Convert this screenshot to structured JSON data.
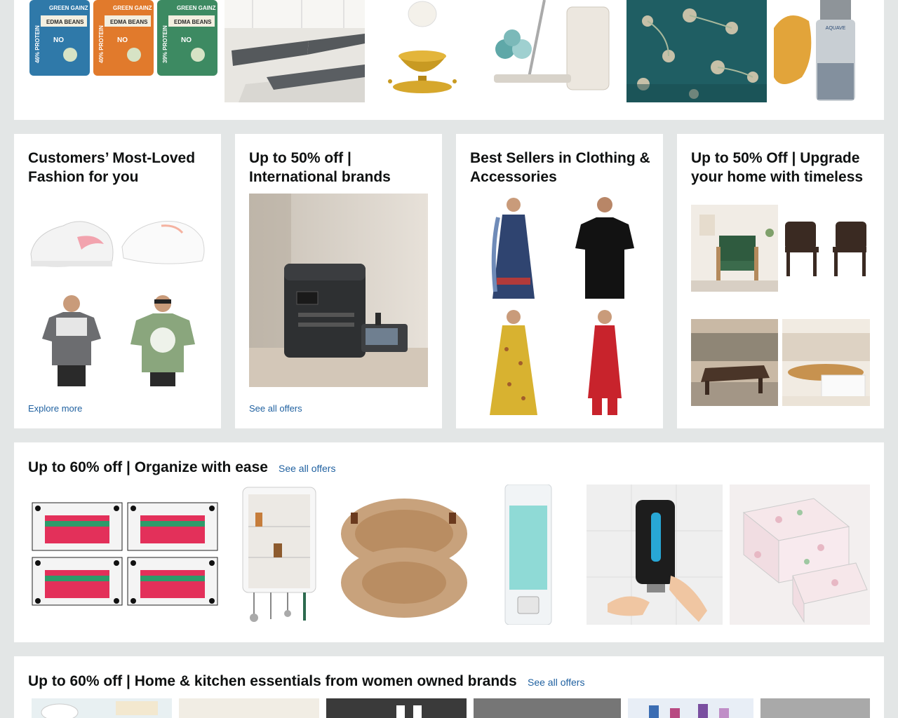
{
  "row1": {
    "products": [
      {
        "icon": "protein-snack-pouches"
      },
      {
        "icon": "kitchen-floor-mats"
      },
      {
        "icon": "brass-diya-lamp"
      },
      {
        "icon": "spin-mop-bucket"
      },
      {
        "icon": "floral-bedsheet"
      },
      {
        "icon": "face-serum-bottle"
      }
    ],
    "pouch_labels": [
      "GREEN GAINZ",
      "EDMA BEANS",
      "NO"
    ],
    "pouch_side": [
      "46% PROTEIN",
      "40% PROTEIN",
      "39% PROTEIN"
    ],
    "serum_label": "AQUAVE"
  },
  "cards": [
    {
      "title": "Customers’ Most-Loved Fashion for you",
      "link": "Explore more"
    },
    {
      "title": "Up to 50% off | International brands",
      "link": "See all offers"
    },
    {
      "title": "Best Sellers in Clothing & Accessories",
      "link": ""
    },
    {
      "title": "Up to 50% Off | Upgrade your home with timeless",
      "link": ""
    }
  ],
  "organize": {
    "title": "Up to 60% off | Organize with ease",
    "link": "See all offers",
    "products": [
      "storage-boxes",
      "wall-organizer-shelf",
      "jute-baskets",
      "soap-dispenser",
      "wall-dispenser-hand",
      "underbed-storage-bag"
    ]
  },
  "women_owned": {
    "title": "Up to 60% off | Home & kitchen essentials from women owned brands",
    "link": "See all offers"
  },
  "colors": {
    "link": "#2162a1",
    "page_bg": "#e3e6e6",
    "card_bg": "#ffffff"
  }
}
